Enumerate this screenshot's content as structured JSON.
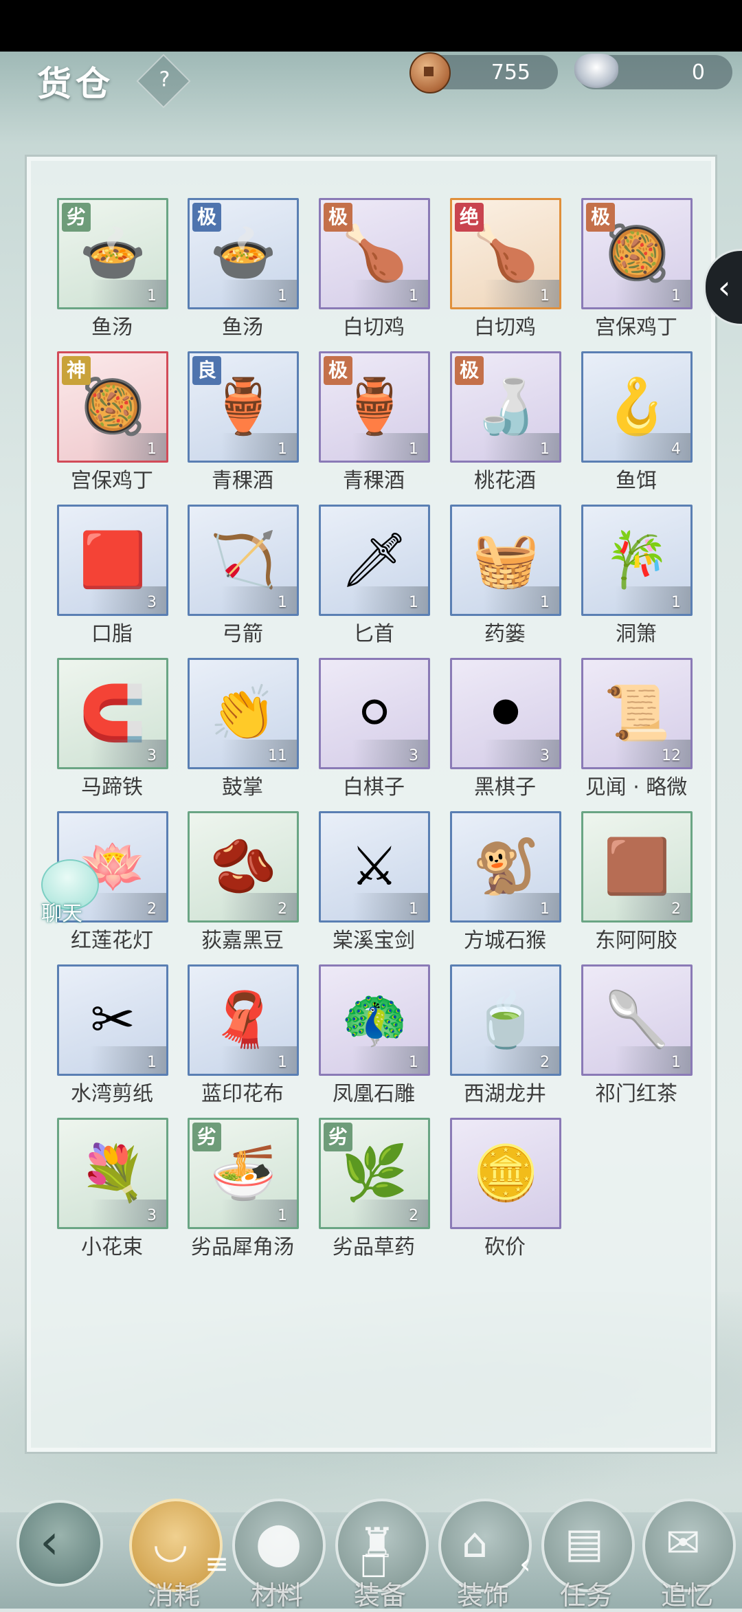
{
  "header": {
    "title": "货仓",
    "help": "?",
    "coins": "755",
    "silver": "0"
  },
  "items": [
    {
      "label": "鱼汤",
      "count": "1",
      "badge": "劣",
      "grade": "green",
      "icon": "fish-soup"
    },
    {
      "label": "鱼汤",
      "count": "1",
      "badge": "极",
      "grade": "blue",
      "icon": "fish-soup"
    },
    {
      "label": "白切鸡",
      "count": "1",
      "badge": "极",
      "grade": "purple",
      "icon": "chicken"
    },
    {
      "label": "白切鸡",
      "count": "1",
      "badge": "绝",
      "grade": "orange",
      "icon": "chicken"
    },
    {
      "label": "宫保鸡丁",
      "count": "1",
      "badge": "极",
      "grade": "purple",
      "icon": "kungpao"
    },
    {
      "label": "宫保鸡丁",
      "count": "1",
      "badge": "神",
      "grade": "red",
      "icon": "kungpao"
    },
    {
      "label": "青稞酒",
      "count": "1",
      "badge": "良",
      "grade": "blue",
      "icon": "wine-jar"
    },
    {
      "label": "青稞酒",
      "count": "1",
      "badge": "极",
      "grade": "purple",
      "icon": "wine-jar"
    },
    {
      "label": "桃花酒",
      "count": "1",
      "badge": "极",
      "grade": "purple",
      "icon": "peach-wine"
    },
    {
      "label": "鱼饵",
      "count": "4",
      "badge": "",
      "grade": "blue",
      "icon": "bait"
    },
    {
      "label": "口脂",
      "count": "3",
      "badge": "",
      "grade": "blue",
      "icon": "rouge"
    },
    {
      "label": "弓箭",
      "count": "1",
      "badge": "",
      "grade": "blue",
      "icon": "bow"
    },
    {
      "label": "匕首",
      "count": "1",
      "badge": "",
      "grade": "blue",
      "icon": "dagger"
    },
    {
      "label": "药篓",
      "count": "1",
      "badge": "",
      "grade": "blue",
      "icon": "basket"
    },
    {
      "label": "洞箫",
      "count": "1",
      "badge": "",
      "grade": "blue",
      "icon": "flute"
    },
    {
      "label": "马蹄铁",
      "count": "3",
      "badge": "",
      "grade": "green",
      "icon": "horseshoe"
    },
    {
      "label": "鼓掌",
      "count": "11",
      "badge": "",
      "grade": "blue",
      "icon": "clap"
    },
    {
      "label": "白棋子",
      "count": "3",
      "badge": "",
      "grade": "purple",
      "icon": "white-stone"
    },
    {
      "label": "黑棋子",
      "count": "3",
      "badge": "",
      "grade": "purple",
      "icon": "black-stone"
    },
    {
      "label": "见闻 · 略微",
      "count": "12",
      "badge": "",
      "grade": "purple",
      "icon": "scroll"
    },
    {
      "label": "红莲花灯",
      "count": "2",
      "badge": "",
      "grade": "blue",
      "icon": "lotus-lamp"
    },
    {
      "label": "荻嘉黑豆",
      "count": "2",
      "badge": "",
      "grade": "green",
      "icon": "bean-jar"
    },
    {
      "label": "棠溪宝剑",
      "count": "1",
      "badge": "",
      "grade": "blue",
      "icon": "sword"
    },
    {
      "label": "方城石猴",
      "count": "1",
      "badge": "",
      "grade": "blue",
      "icon": "stone-monkey"
    },
    {
      "label": "东阿阿胶",
      "count": "2",
      "badge": "",
      "grade": "green",
      "icon": "gelatin"
    },
    {
      "label": "水湾剪纸",
      "count": "1",
      "badge": "",
      "grade": "blue",
      "icon": "paper-cut"
    },
    {
      "label": "蓝印花布",
      "count": "1",
      "badge": "",
      "grade": "blue",
      "icon": "cloth"
    },
    {
      "label": "凤凰石雕",
      "count": "1",
      "badge": "",
      "grade": "purple",
      "icon": "phoenix"
    },
    {
      "label": "西湖龙井",
      "count": "2",
      "badge": "",
      "grade": "blue",
      "icon": "tea"
    },
    {
      "label": "祁门红茶",
      "count": "1",
      "badge": "",
      "grade": "purple",
      "icon": "black-tea"
    },
    {
      "label": "小花束",
      "count": "3",
      "badge": "",
      "grade": "green",
      "icon": "flowers"
    },
    {
      "label": "劣品犀角汤",
      "count": "1",
      "badge": "劣",
      "grade": "green",
      "icon": "soup"
    },
    {
      "label": "劣品草药",
      "count": "2",
      "badge": "劣",
      "grade": "green",
      "icon": "herb"
    },
    {
      "label": "砍价",
      "count": "",
      "badge": "",
      "grade": "purple",
      "icon": "coin-deal"
    }
  ],
  "chat": {
    "label": "聊天"
  },
  "tabs": [
    {
      "label": "消耗",
      "icon": "bowl",
      "active": true
    },
    {
      "label": "材料",
      "icon": "materials",
      "active": false
    },
    {
      "label": "装备",
      "icon": "robe",
      "active": false
    },
    {
      "label": "装饰",
      "icon": "pavilion",
      "active": false
    },
    {
      "label": "任务",
      "icon": "book",
      "active": false
    },
    {
      "label": "追忆",
      "icon": "envelope",
      "active": false
    }
  ],
  "nav": {
    "menu": "≡",
    "home": "□",
    "back": "‹"
  },
  "colors": {
    "green": "#6aa584",
    "blue": "#5a7fb3",
    "purple": "#8a7ab6",
    "orange": "#e08f3a",
    "red": "#d24b58",
    "badge_green": "#6e9c79",
    "badge_blue": "#4f74ae",
    "badge_purple": "#c4704a",
    "badge_orange": "#c9444f",
    "badge_red": "#c9a23a"
  }
}
